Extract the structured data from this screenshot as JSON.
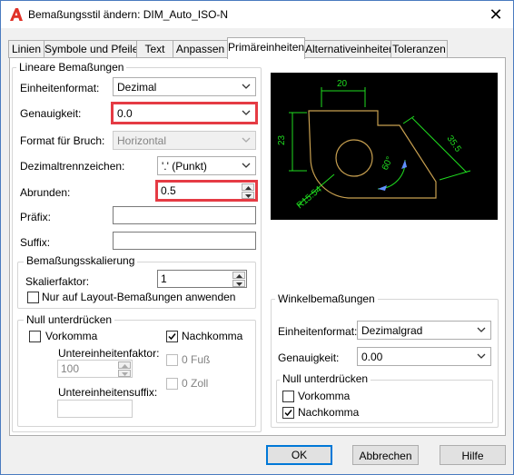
{
  "window": {
    "title": "Bemaßungsstil ändern: DIM_Auto_ISO-N",
    "close_glyph": "✕"
  },
  "tabs": [
    "Linien",
    "Symbole und Pfeile",
    "Text",
    "Anpassen",
    "Primäreinheiten",
    "Alternativeinheiten",
    "Toleranzen"
  ],
  "active_tab": "Primäreinheiten",
  "linear": {
    "group_title": "Lineare Bemaßungen",
    "unit_format": {
      "label": "Einheitenformat:",
      "value": "Dezimal"
    },
    "precision": {
      "label": "Genauigkeit:",
      "value": "0.0"
    },
    "fraction_format": {
      "label": "Format für Bruch:",
      "value": "Horizontal"
    },
    "decimal_separator": {
      "label": "Dezimaltrennzeichen:",
      "value": "'.' (Punkt)"
    },
    "round_off": {
      "label": "Abrunden:",
      "value": "0.5"
    },
    "prefix": {
      "label": "Präfix:",
      "value": ""
    },
    "suffix": {
      "label": "Suffix:",
      "value": ""
    }
  },
  "scale": {
    "group_title": "Bemaßungsskalierung",
    "factor_label": "Skalierfaktor:",
    "factor_value": "1",
    "layout_only_label": "Nur auf Layout-Bemaßungen anwenden",
    "layout_only_checked": false
  },
  "zero_suppression": {
    "group_title": "Null unterdrücken",
    "leading": {
      "label": "Vorkomma",
      "checked": false
    },
    "trailing": {
      "label": "Nachkomma",
      "checked": true
    },
    "sub_unit_factor_label": "Untereinheitenfaktor:",
    "sub_unit_factor_value": "100",
    "feet": {
      "label": "0 Fuß",
      "checked": false
    },
    "inches": {
      "label": "0 Zoll",
      "checked": false
    },
    "sub_unit_suffix_label": "Untereinheitensuffix:",
    "sub_unit_suffix_value": ""
  },
  "preview": {
    "dims": [
      "20",
      "23",
      "35.5",
      "60°",
      "R15.54"
    ]
  },
  "angular": {
    "group_title": "Winkelbemaßungen",
    "unit_format": {
      "label": "Einheitenformat:",
      "value": "Dezimalgrad"
    },
    "precision": {
      "label": "Genauigkeit:",
      "value": "0.00"
    },
    "zero_group_title": "Null unterdrücken",
    "leading": {
      "label": "Vorkomma",
      "checked": false
    },
    "trailing": {
      "label": "Nachkomma",
      "checked": true
    }
  },
  "buttons": {
    "ok": "OK",
    "cancel": "Abbrechen",
    "help": "Hilfe"
  },
  "colors": {
    "highlight": "#e53b44",
    "preview_geometry": "#c8a050",
    "preview_dimension": "#1fdc1f",
    "preview_arrow": "#6090ff"
  }
}
